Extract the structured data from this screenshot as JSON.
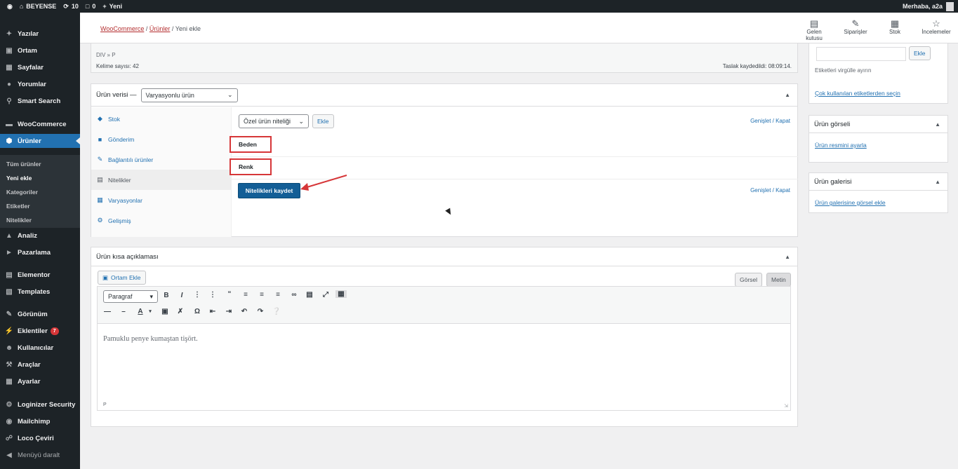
{
  "adminbar": {
    "site_name": "BEYENSE",
    "updates_count": "10",
    "comments_count": "0",
    "new_label": "Yeni",
    "greeting": "Merhaba, a2a"
  },
  "sidebar": {
    "items": [
      {
        "label": "Yazılar",
        "icon": "pin-icon"
      },
      {
        "label": "Ortam",
        "icon": "media-icon"
      },
      {
        "label": "Sayfalar",
        "icon": "pages-icon"
      },
      {
        "label": "Yorumlar",
        "icon": "comments-icon"
      },
      {
        "label": "Smart Search",
        "icon": "search-icon"
      },
      {
        "label": "WooCommerce",
        "icon": "woocommerce-icon"
      },
      {
        "label": "Ürünler",
        "icon": "products-icon"
      },
      {
        "label": "Analiz",
        "icon": "analytics-icon"
      },
      {
        "label": "Pazarlama",
        "icon": "megaphone-icon"
      },
      {
        "label": "Elementor",
        "icon": "elementor-icon"
      },
      {
        "label": "Templates",
        "icon": "folder-icon"
      },
      {
        "label": "Görünüm",
        "icon": "brush-icon"
      },
      {
        "label": "Eklentiler",
        "icon": "plugin-icon",
        "badge": "7"
      },
      {
        "label": "Kullanıcılar",
        "icon": "users-icon"
      },
      {
        "label": "Araçlar",
        "icon": "tools-icon"
      },
      {
        "label": "Ayarlar",
        "icon": "settings-icon"
      },
      {
        "label": "Loginizer Security",
        "icon": "gear-icon"
      },
      {
        "label": "Mailchimp",
        "icon": "mailchimp-icon"
      },
      {
        "label": "Loco Çeviri",
        "icon": "translate-icon"
      },
      {
        "label": "Menüyü daralt",
        "icon": "collapse-icon"
      }
    ],
    "submenu": [
      "Tüm ürünler",
      "Yeni ekle",
      "Kategoriler",
      "Etiketler",
      "Nitelikler"
    ]
  },
  "header": {
    "crumb_woocommerce": "WooCommerce",
    "crumb_products": "Ürünler",
    "crumb_current": "Yeni ekle",
    "btn_inbox": "Gelen kutusu",
    "btn_orders": "Siparişler",
    "btn_stock": "Stok",
    "btn_reviews": "İncelemeler"
  },
  "status": {
    "path": "DIV » P",
    "word_count": "Kelime sayısı: 42",
    "saved": "Taslak kaydedildi: 08:09:14."
  },
  "product_data": {
    "heading": "Ürün verisi —",
    "type_select": "Varyasyonlu ürün",
    "tabs": [
      {
        "label": "Stok",
        "icon": "stock-icon"
      },
      {
        "label": "Gönderim",
        "icon": "shipping-icon"
      },
      {
        "label": "Bağlantılı ürünler",
        "icon": "link-icon"
      },
      {
        "label": "Nitelikler",
        "icon": "attributes-icon"
      },
      {
        "label": "Varyasyonlar",
        "icon": "variations-icon"
      },
      {
        "label": "Gelişmiş",
        "icon": "advanced-icon"
      }
    ],
    "attribute_select": "Özel ürün niteliği",
    "add_button": "Ekle",
    "expand_close": "Genişlet / Kapat",
    "attributes": [
      "Beden",
      "Renk"
    ],
    "save_attributes": "Nitelikleri kaydet"
  },
  "short_desc": {
    "heading": "Ürün kısa açıklaması",
    "add_media": "Ortam Ekle",
    "tab_visual": "Görsel",
    "tab_text": "Metin",
    "format_select": "Paragraf",
    "content": "Pamuklu penye kumaştan tişört.",
    "footer_path": "P"
  },
  "right": {
    "tags_add": "Ekle",
    "tags_hint": "Etiketleri virgülle ayırın",
    "tags_choose": "Çok kullanılan etiketlerden seçin",
    "image_heading": "Ürün görseli",
    "image_link": "Ürün resmini ayarla",
    "gallery_heading": "Ürün galerisi",
    "gallery_link": "Ürün galerisine görsel ekle"
  },
  "colors": {
    "admin_dark": "#1d2327",
    "active_blue": "#2271b1",
    "highlight_red": "#d63638",
    "primary_button": "#135e96"
  }
}
